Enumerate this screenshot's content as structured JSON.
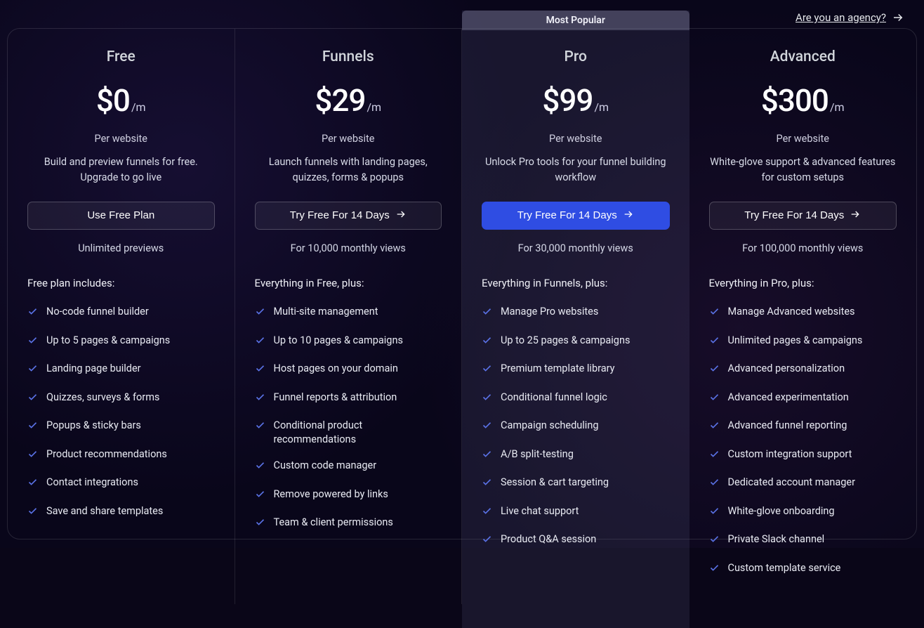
{
  "top_link": "Are you an agency?",
  "popular_badge": "Most Popular",
  "per_suffix": "/m",
  "per_website": "Per website",
  "plans": [
    {
      "name": "Free",
      "price": "$0",
      "desc": "Build and preview funnels for free. Upgrade to go live",
      "cta": "Use Free Plan",
      "cta_arrow": false,
      "primary": false,
      "post": "Unlimited previews",
      "includes_head": "Free plan includes:",
      "features": [
        "No-code funnel builder",
        "Up to 5 pages & campaigns",
        "Landing page builder",
        "Quizzes, surveys & forms",
        "Popups & sticky bars",
        "Product recommendations",
        "Contact integrations",
        "Save and share templates"
      ]
    },
    {
      "name": "Funnels",
      "price": "$29",
      "desc": "Launch funnels with landing pages, quizzes, forms & popups",
      "cta": "Try Free For 14 Days",
      "cta_arrow": true,
      "primary": false,
      "post": "For 10,000 monthly views",
      "includes_head": "Everything in Free, plus:",
      "features": [
        "Multi-site management",
        "Up to 10 pages & campaigns",
        "Host pages on your domain",
        "Funnel reports & attribution",
        "Conditional product recommendations",
        "Custom code manager",
        "Remove powered by links",
        "Team & client permissions"
      ]
    },
    {
      "name": "Pro",
      "price": "$99",
      "desc": "Unlock Pro tools for your funnel building workflow",
      "cta": "Try Free For 14 Days",
      "cta_arrow": true,
      "primary": true,
      "popular": true,
      "post": "For 30,000 monthly views",
      "includes_head": "Everything in Funnels, plus:",
      "features": [
        "Manage Pro websites",
        "Up to 25 pages & campaigns",
        "Premium template library",
        "Conditional funnel logic",
        "Campaign scheduling",
        "A/B split-testing",
        "Session & cart targeting",
        "Live chat support",
        "Product Q&A session"
      ]
    },
    {
      "name": "Advanced",
      "price": "$300",
      "desc": "White-glove support & advanced features for custom setups",
      "cta": "Try Free For 14 Days",
      "cta_arrow": true,
      "primary": false,
      "post": "For 100,000 monthly views",
      "includes_head": "Everything in Pro, plus:",
      "features": [
        "Manage Advanced websites",
        "Unlimited pages & campaigns",
        "Advanced personalization",
        "Advanced experimentation",
        "Advanced funnel reporting",
        "Custom integration support",
        "Dedicated account manager",
        "White-glove onboarding",
        "Private Slack channel",
        "Custom template service"
      ]
    }
  ]
}
